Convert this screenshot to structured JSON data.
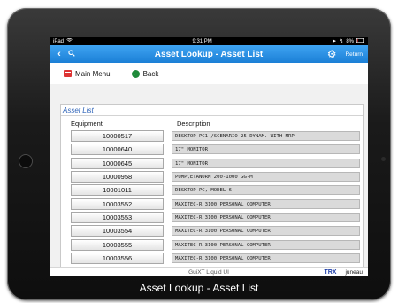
{
  "status_bar": {
    "device": "iPad",
    "time": "9:31 PM",
    "battery": "8%"
  },
  "nav_bar": {
    "back_icon": "chevron-left-icon",
    "search_icon": "search-icon",
    "title": "Asset Lookup - Asset List",
    "gear_icon": "gear-icon",
    "return_label": "Return"
  },
  "toolbar": {
    "main_menu_label": "Main Menu",
    "back_label": "Back"
  },
  "asset_list": {
    "title": "Asset List",
    "columns": {
      "equipment": "Equipment",
      "description": "Description"
    },
    "rows": [
      {
        "equipment": "10000517",
        "description": "DESKTOP PC1 /SCENARIO 25 DYNAM. WITH MRP"
      },
      {
        "equipment": "10000640",
        "description": "17\" MONITOR"
      },
      {
        "equipment": "10000645",
        "description": "17\" MONITOR"
      },
      {
        "equipment": "10000958",
        "description": "PUMP,ETANORM 200-1000 GG-M"
      },
      {
        "equipment": "10001011",
        "description": "DESKTOP PC, MODEL 6"
      },
      {
        "equipment": "10003552",
        "description": "MAXITEC-R 3100 PERSONAL COMPUTER"
      },
      {
        "equipment": "10003553",
        "description": "MAXITEC-R 3100 PERSONAL COMPUTER"
      },
      {
        "equipment": "10003554",
        "description": "MAXITEC-R 3100 PERSONAL COMPUTER"
      },
      {
        "equipment": "10003555",
        "description": "MAXITEC-R 3100 PERSONAL COMPUTER"
      },
      {
        "equipment": "10003556",
        "description": "MAXITEC-R 3100 PERSONAL COMPUTER"
      }
    ]
  },
  "footer": {
    "product": "GuiXT Liquid UI",
    "trx": "TRX",
    "brand": "juneau"
  },
  "caption": "Asset Lookup - Asset List"
}
